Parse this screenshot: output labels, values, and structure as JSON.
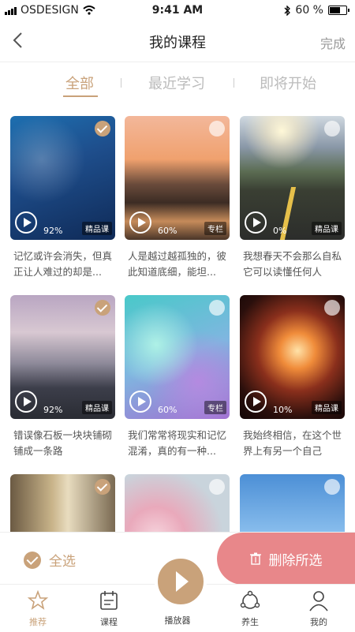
{
  "status": {
    "carrier": "OSDESIGN",
    "time": "9:41 AM",
    "battery": "60 %"
  },
  "nav": {
    "title": "我的课程",
    "done": "完成"
  },
  "tabs": [
    {
      "label": "全部",
      "active": true
    },
    {
      "label": "最近学习",
      "active": false
    },
    {
      "label": "即将开始",
      "active": false
    }
  ],
  "courses": [
    {
      "progress": "92%",
      "tag": "精品课",
      "desc": "记忆或许会消失，但真正让人难过的却是...",
      "checked": true
    },
    {
      "progress": "60%",
      "tag": "专栏",
      "desc": "人是越过越孤独的，彼此知道底细，能坦...",
      "checked": false
    },
    {
      "progress": "0%",
      "tag": "精品课",
      "desc": "我想春天不会那么自私它可以读懂任何人",
      "checked": false
    },
    {
      "progress": "92%",
      "tag": "精品课",
      "desc": "错误像石板一块块铺砌铺成一条路",
      "checked": true
    },
    {
      "progress": "60%",
      "tag": "专栏",
      "desc": "我们常常将现实和记忆混淆，真的有一种...",
      "checked": false
    },
    {
      "progress": "10%",
      "tag": "精品课",
      "desc": "我始终相信，在这个世界上有另一个自己",
      "checked": false
    },
    {
      "checked": true
    },
    {
      "checked": false
    },
    {
      "checked": false
    }
  ],
  "actions": {
    "select_all": "全选",
    "delete": "删除所选"
  },
  "tabbar": [
    {
      "label": "推荐",
      "icon": "star-icon",
      "active": true
    },
    {
      "label": "课程",
      "icon": "calendar-icon",
      "active": false
    },
    {
      "label": "播放器",
      "icon": "play-icon",
      "active": false
    },
    {
      "label": "养生",
      "icon": "molecule-icon",
      "active": false
    },
    {
      "label": "我的",
      "icon": "person-icon",
      "active": false
    }
  ],
  "colors": {
    "accent": "#c9a27a",
    "delete": "#e8878a"
  }
}
